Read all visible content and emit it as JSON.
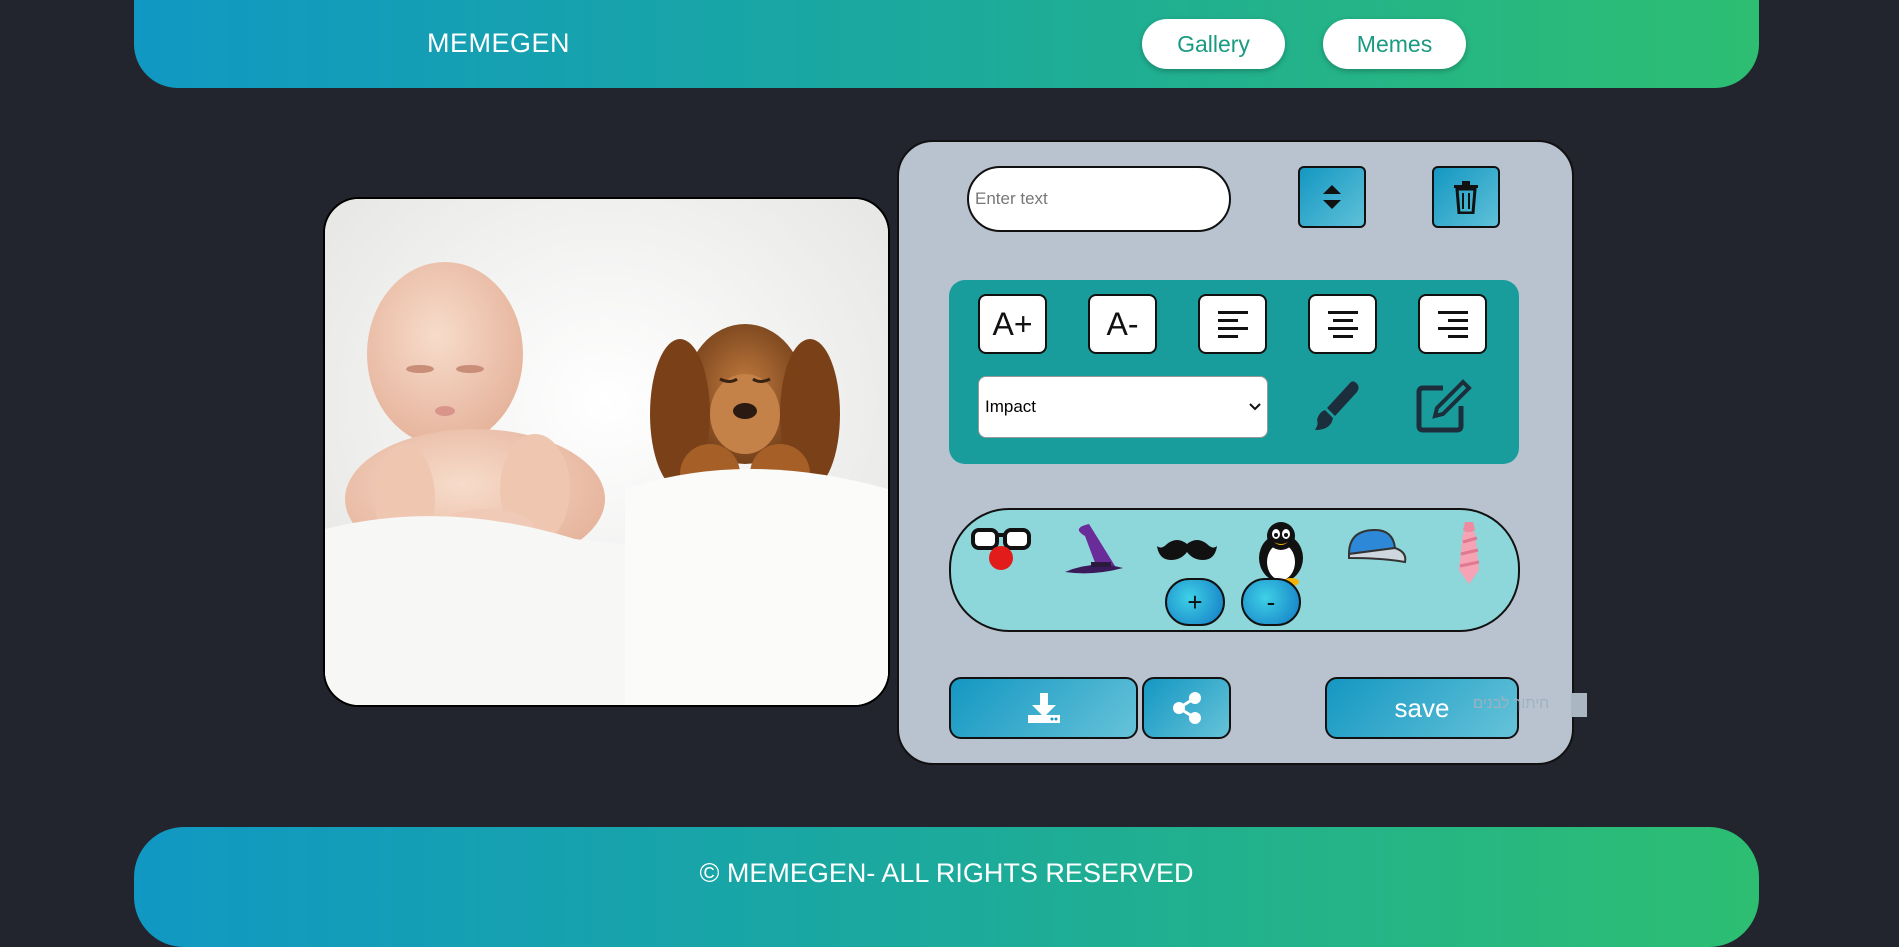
{
  "header": {
    "logo": "MEMEGEN",
    "nav": [
      {
        "label": "Gallery"
      },
      {
        "label": "Memes"
      }
    ]
  },
  "editor": {
    "text_input": {
      "value": "",
      "placeholder": "Enter text"
    },
    "font_size_up_label": "A+",
    "font_size_down_label": "A-",
    "font_select": {
      "selected": "Impact"
    },
    "stickers": [
      "glasses-nose-sticker",
      "witch-hat-sticker",
      "mustache-sticker",
      "penguin-sticker",
      "cap-sticker",
      "tie-sticker"
    ],
    "sticker_add_label": "+",
    "sticker_remove_label": "-",
    "save_label": "save",
    "hidden_label": "חיתוך לבנים"
  },
  "footer": {
    "text": "© MEMEGEN- ALL RIGHTS RESERVED"
  },
  "colors": {
    "background": "#22252d",
    "header_gradient_start": "#1198c3",
    "header_gradient_end": "#2dbe72",
    "editor_bg": "#b8c3cf",
    "teal_panel": "#199d9c",
    "sticker_panel": "#8dd6da",
    "nav_text": "#1a9a82"
  }
}
